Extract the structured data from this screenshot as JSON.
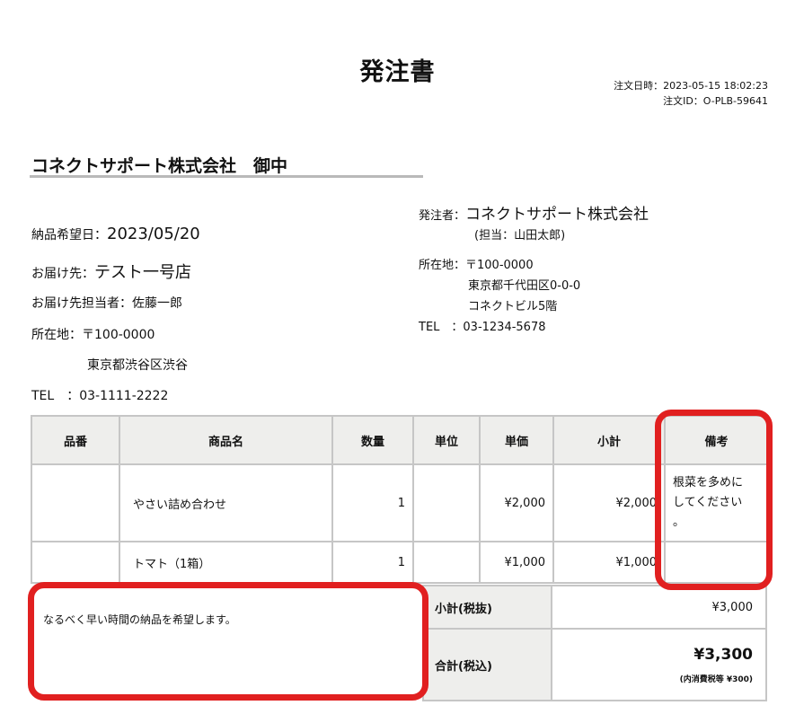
{
  "doc": {
    "title": "発注書",
    "order_date": "注文日時：2023-05-15 18:02:23",
    "order_id": "注文ID：O-PLB-59641",
    "recipient": "コネクトサポート株式会社　御中"
  },
  "delivery": {
    "date_label": "納品希望日：",
    "date_value": "2023/05/20",
    "dest_label": "お届け先：",
    "dest_value": "テスト一号店",
    "contact": "お届け先担当者：佐藤一郎",
    "addr_label": "所在地：〒100-0000",
    "addr_line2": "東京都渋谷区渋谷",
    "tel": "TEL　：03-1111-2222"
  },
  "sender": {
    "label": "発注者：",
    "company": "コネクトサポート株式会社",
    "person": "(担当：山田太郎)",
    "addr1": "所在地：〒100-0000",
    "addr2": "東京都千代田区0-0-0",
    "addr3": "コネクトビル5階",
    "tel": "TEL　：03-1234-5678"
  },
  "table": {
    "headers": [
      "品番",
      "商品名",
      "数量",
      "単位",
      "単価",
      "小計",
      "備考"
    ],
    "rows": [
      {
        "code": "",
        "name": "やさい詰め合わせ",
        "qty": "1",
        "unit": "",
        "price": "¥2,000",
        "subtotal": "¥2,000",
        "note_l1": "根菜を多めに",
        "note_l2": "してください",
        "note_l3": "。"
      },
      {
        "code": "",
        "name": "トマト（1箱）",
        "qty": "1",
        "unit": "",
        "price": "¥1,000",
        "subtotal": "¥1,000",
        "note_l1": "",
        "note_l2": "",
        "note_l3": ""
      }
    ]
  },
  "remarks": "なるべく早い時間の納品を希望します。",
  "totals": {
    "subtotal_label": "小計(税抜)",
    "subtotal_value": "¥3,000",
    "total_label": "合計(税込)",
    "total_value": "¥3,300",
    "tax_note": "(内消費税等 ¥300)"
  },
  "highlight_color": "#e12020"
}
